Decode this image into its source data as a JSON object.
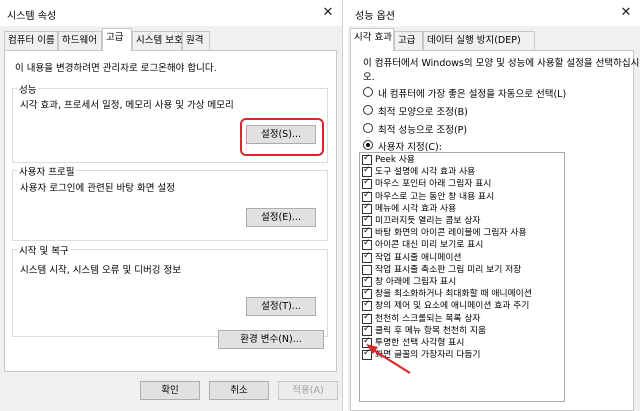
{
  "left": {
    "title": "시스템 속성",
    "close_glyph": "✕",
    "tabs": [
      "컴퓨터 이름",
      "하드웨어",
      "고급",
      "시스템 보호",
      "원격"
    ],
    "admin_note": "이 내용을 변경하려면 관리자로 로그온해야 합니다.",
    "groups": [
      {
        "title": "성능",
        "desc": "시각 효과, 프로세서 일정, 메모리 사용 및 가상 메모리",
        "button": "설정(S)..."
      },
      {
        "title": "사용자 프로필",
        "desc": "사용자 로그인에 관련된 바탕 화면 설정",
        "button": "설정(E)..."
      },
      {
        "title": "시작 및 복구",
        "desc": "시스템 시작, 시스템 오류 및 디버깅 정보",
        "button": "설정(T)..."
      }
    ],
    "env_button": "환경 변수(N)...",
    "ok": "확인",
    "cancel": "취소",
    "apply": "적용(A)"
  },
  "right": {
    "title": "성능 옵션",
    "close_glyph": "✕",
    "tabs": [
      "시각 효과",
      "고급",
      "데이터 실행 방지(DEP)"
    ],
    "desc_line1": "이 컴퓨터에서 Windows의 모양 및 성능에 사용할 설정을 선택하십시",
    "desc_line2": "오.",
    "radios": [
      {
        "label": "내 컴퓨터에 가장 좋은 설정을 자동으로 선택(L)",
        "selected": false
      },
      {
        "label": "최적 모양으로 조정(B)",
        "selected": false
      },
      {
        "label": "최적 성능으로 조정(P)",
        "selected": false
      },
      {
        "label": "사용자 지정(C):",
        "selected": true
      }
    ],
    "checkboxes": [
      {
        "label": "Peek 사용",
        "checked": true
      },
      {
        "label": "도구 설명에 시각 효과 사용",
        "checked": true
      },
      {
        "label": "마우스 포인터 아래 그림자 표시",
        "checked": true
      },
      {
        "label": "마우스로 고는 동안 창 내용 표시",
        "checked": true
      },
      {
        "label": "메뉴에 시각 효과 사용",
        "checked": true
      },
      {
        "label": "미끄러지듯 열리는 콤보 상자",
        "checked": true
      },
      {
        "label": "바탕 화면의 아이콘 레이블에 그림자 사용",
        "checked": true
      },
      {
        "label": "아이콘 대신 미리 보기로 표시",
        "checked": true
      },
      {
        "label": "작업 표시줄 애니메이션",
        "checked": true
      },
      {
        "label": "작업 표시줄 축소판 그림 미리 보기 저장",
        "checked": false
      },
      {
        "label": "창 아래에 그림자 표시",
        "checked": true
      },
      {
        "label": "창을 최소화하거나 최대화할 때 애니메이션",
        "checked": true
      },
      {
        "label": "창의 제어 및 요소에 애니메이션 효과 주기",
        "checked": true
      },
      {
        "label": "천천히 스크롤되는 목록 상자",
        "checked": true
      },
      {
        "label": "클릭 후 메뉴 항목 천천히 지움",
        "checked": true
      },
      {
        "label": "투명한 선택 사각형 표시",
        "checked": true
      },
      {
        "label": "화면 글꼴의 가장자리 다듬기",
        "checked": true
      }
    ]
  },
  "colors": {
    "highlight": "#d9282e",
    "arrow": "#d9282e"
  }
}
